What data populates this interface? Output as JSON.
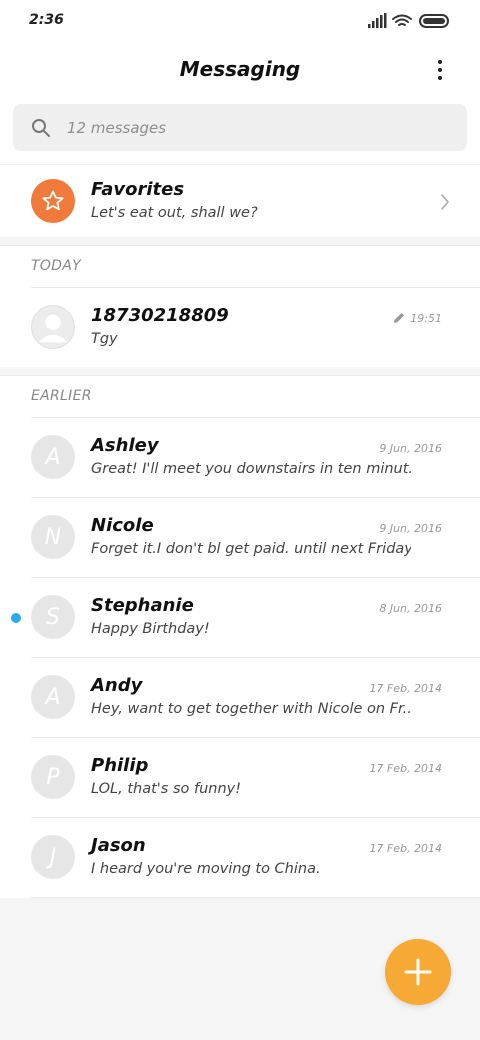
{
  "status_bar": {
    "time": "2:36",
    "icons": [
      "signal-icon",
      "wifi-icon",
      "battery-icon"
    ]
  },
  "header": {
    "title": "Messaging",
    "menu_icon": "more-vertical-icon"
  },
  "search": {
    "placeholder": "12 messages",
    "icon": "search-icon"
  },
  "favorites": {
    "title": "Favorites",
    "preview": "Let's eat out, shall we?",
    "icon": "star-icon",
    "chevron_icon": "chevron-right-icon",
    "avatar_color": "#f07a3c"
  },
  "today": {
    "header": "TODAY",
    "items": [
      {
        "name": "18730218809",
        "preview": "Tgy",
        "date": "19:51",
        "draft_icon": "pencil-icon",
        "avatar_icon": "person-icon"
      }
    ]
  },
  "earlier": {
    "header": "EARLIER",
    "items": [
      {
        "initial": "A",
        "name": "Ashley",
        "preview": "Great! I'll meet you downstairs in ten minut...",
        "date": "9 Jun, 2016",
        "unread": false
      },
      {
        "initial": "N",
        "name": "Nicole",
        "preview": "Forget it.I don't bl get paid. until next Friday.",
        "date": "9 Jun, 2016",
        "unread": false
      },
      {
        "initial": "S",
        "name": "Stephanie",
        "preview": "Happy Birthday!",
        "date": "8 Jun, 2016",
        "unread": true
      },
      {
        "initial": "A",
        "name": "Andy",
        "preview": "Hey, want to get together with Nicole on Fr...",
        "date": "17 Feb, 2014",
        "unread": false
      },
      {
        "initial": "P",
        "name": "Philip",
        "preview": "LOL, that's so funny!",
        "date": "17 Feb, 2014",
        "unread": false
      },
      {
        "initial": "J",
        "name": "Jason",
        "preview": "I heard you're moving to China.",
        "date": "17 Feb, 2014",
        "unread": false
      }
    ]
  },
  "fab": {
    "icon": "plus-icon",
    "color": "#f7a935"
  },
  "colors": {
    "unread_dot": "#2aa9f0",
    "avatar_gray": "#e6e6e6",
    "background": "#f5f5f5"
  }
}
